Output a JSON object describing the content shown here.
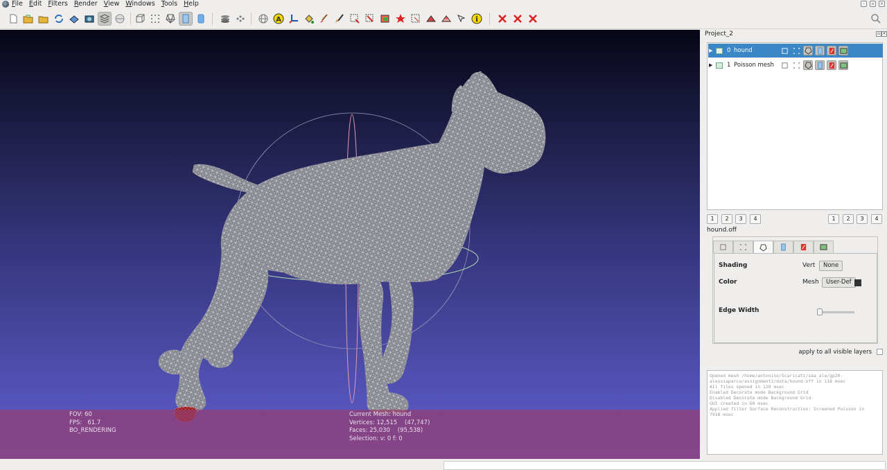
{
  "menubar": {
    "items": [
      {
        "label": "File",
        "u": "F",
        "rest": "ile"
      },
      {
        "label": "Edit",
        "u": "E",
        "rest": "dit"
      },
      {
        "label": "Filters",
        "u": "F",
        "rest": "ilters"
      },
      {
        "label": "Render",
        "u": "R",
        "rest": "ender"
      },
      {
        "label": "View",
        "u": "V",
        "rest": "iew"
      },
      {
        "label": "Windows",
        "u": "W",
        "rest": "indows"
      },
      {
        "label": "Tools",
        "u": "T",
        "rest": "ools"
      },
      {
        "label": "Help",
        "u": "H",
        "rest": "elp"
      }
    ]
  },
  "toolbar": {
    "annotate_letter": "A",
    "info_letter": "i"
  },
  "viewport": {
    "left_info": {
      "fov": "FOV: 60",
      "fps": "FPS:   61.7",
      "mode": "BO_RENDERING"
    },
    "right_info": {
      "current_mesh": "Current Mesh: hound",
      "vertices": "Vertices: 12,515    (47,747)",
      "faces": "Faces: 25,030    (95,538)",
      "selection": "Selection: v: 0 f: 0"
    }
  },
  "layer_panel": {
    "title": "Project_2",
    "layers": [
      {
        "index": "0",
        "name": "hound",
        "selected": true
      },
      {
        "index": "1",
        "name": "Poisson mesh",
        "selected": false
      }
    ],
    "left_numbers": [
      "1",
      "2",
      "3",
      "4"
    ],
    "right_numbers": [
      "1",
      "2",
      "3",
      "4"
    ],
    "filename": "hound.off"
  },
  "properties": {
    "shading_label": "Shading",
    "shading_sub": "Vert",
    "shading_value": "None",
    "color_label": "Color",
    "color_sub": "Mesh",
    "color_value": "User-Def",
    "color_swatch": "#333333",
    "edge_width_label": "Edge Width",
    "edge_width_value": 0.0,
    "apply_all": "apply to all visible layers"
  },
  "log": {
    "lines": [
      "Opened mesh /home/antonino/Scaricati/sea_ale/gp20-\nalessiaparca/assignment2/data/hound.off in 118 msec",
      "All files opened in 120 msec",
      "Enabled Decorate mode Background Grid",
      "Disabled Decorate mode Background Grid",
      "GUI created in 60 msec",
      "Applied filter Surface Reconstruction: Screened Poisson in\n7918 msec"
    ]
  },
  "colors": {
    "selection_blue": "#3a87c8",
    "info_band": "#963c6e",
    "mesh_wire": "#c8c8c8"
  }
}
